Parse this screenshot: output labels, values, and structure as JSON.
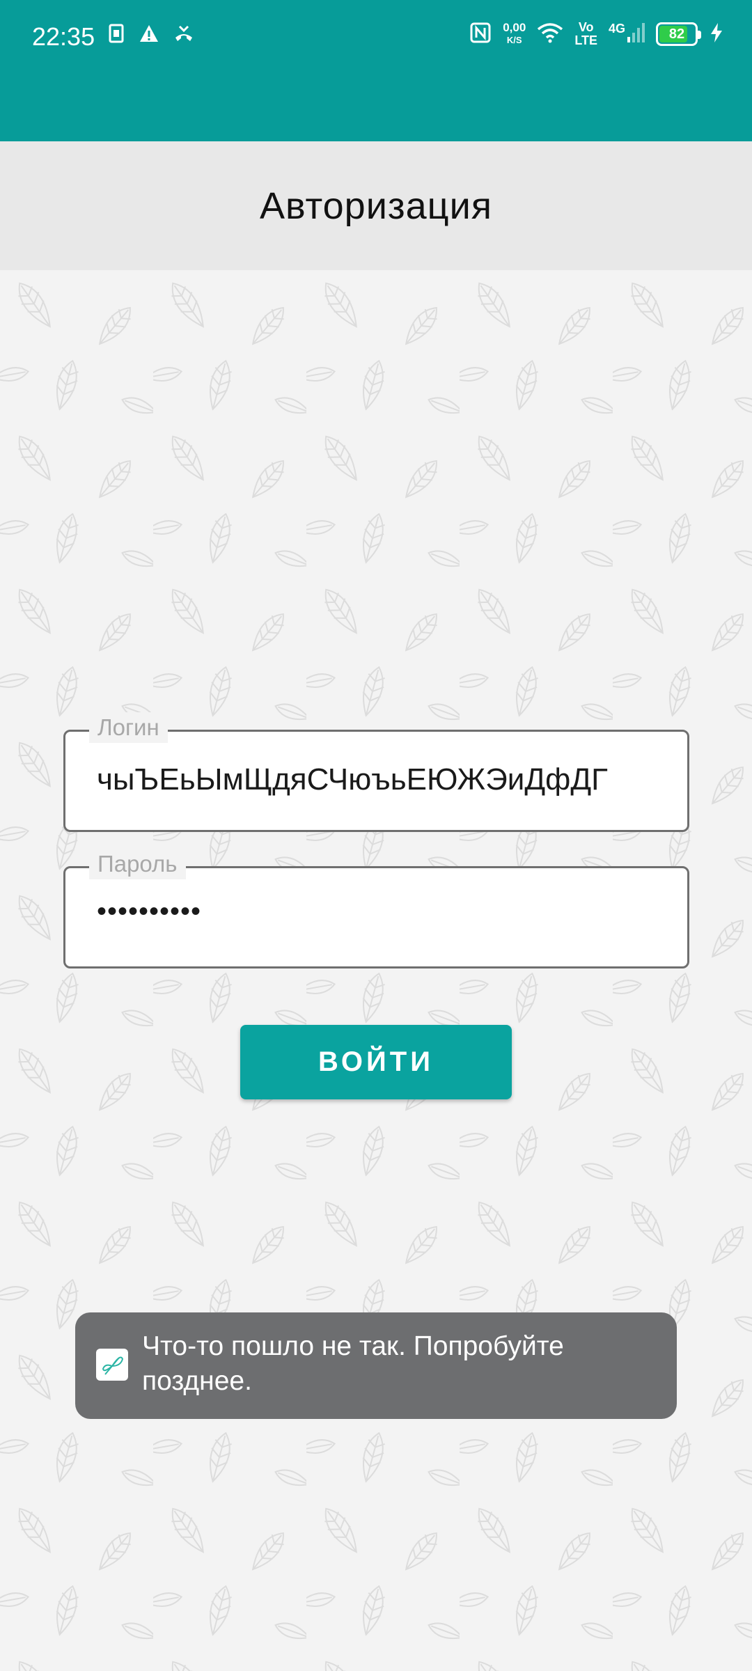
{
  "status_bar": {
    "time": "22:35",
    "net_speed_value": "0,00",
    "net_speed_unit": "K/S",
    "volte_line1": "Vo",
    "volte_line2": "LTE",
    "network_type": "4G",
    "battery_percent": "82",
    "battery_level": 0.82,
    "left_icons": [
      "sim-card-icon",
      "warning-icon",
      "missed-call-icon"
    ],
    "right_icons": [
      "nfc-icon",
      "wifi-icon",
      "signal-icon",
      "charging-icon"
    ],
    "background_color": "#079c99"
  },
  "app_bar": {
    "title": "Авторизация"
  },
  "form": {
    "login_label": "Логин",
    "login_value": "чыЪЕьЫмЩдяСЧюъьЕЮЖЭиДфДГ",
    "password_label": "Пароль",
    "password_value": "••••••••••",
    "submit_label": "ВОЙТИ",
    "accent_color": "#0aa39f"
  },
  "toast": {
    "message": "Что-то пошло не так. Попробуйте позднее.",
    "icon": "app-butterfly-icon"
  }
}
